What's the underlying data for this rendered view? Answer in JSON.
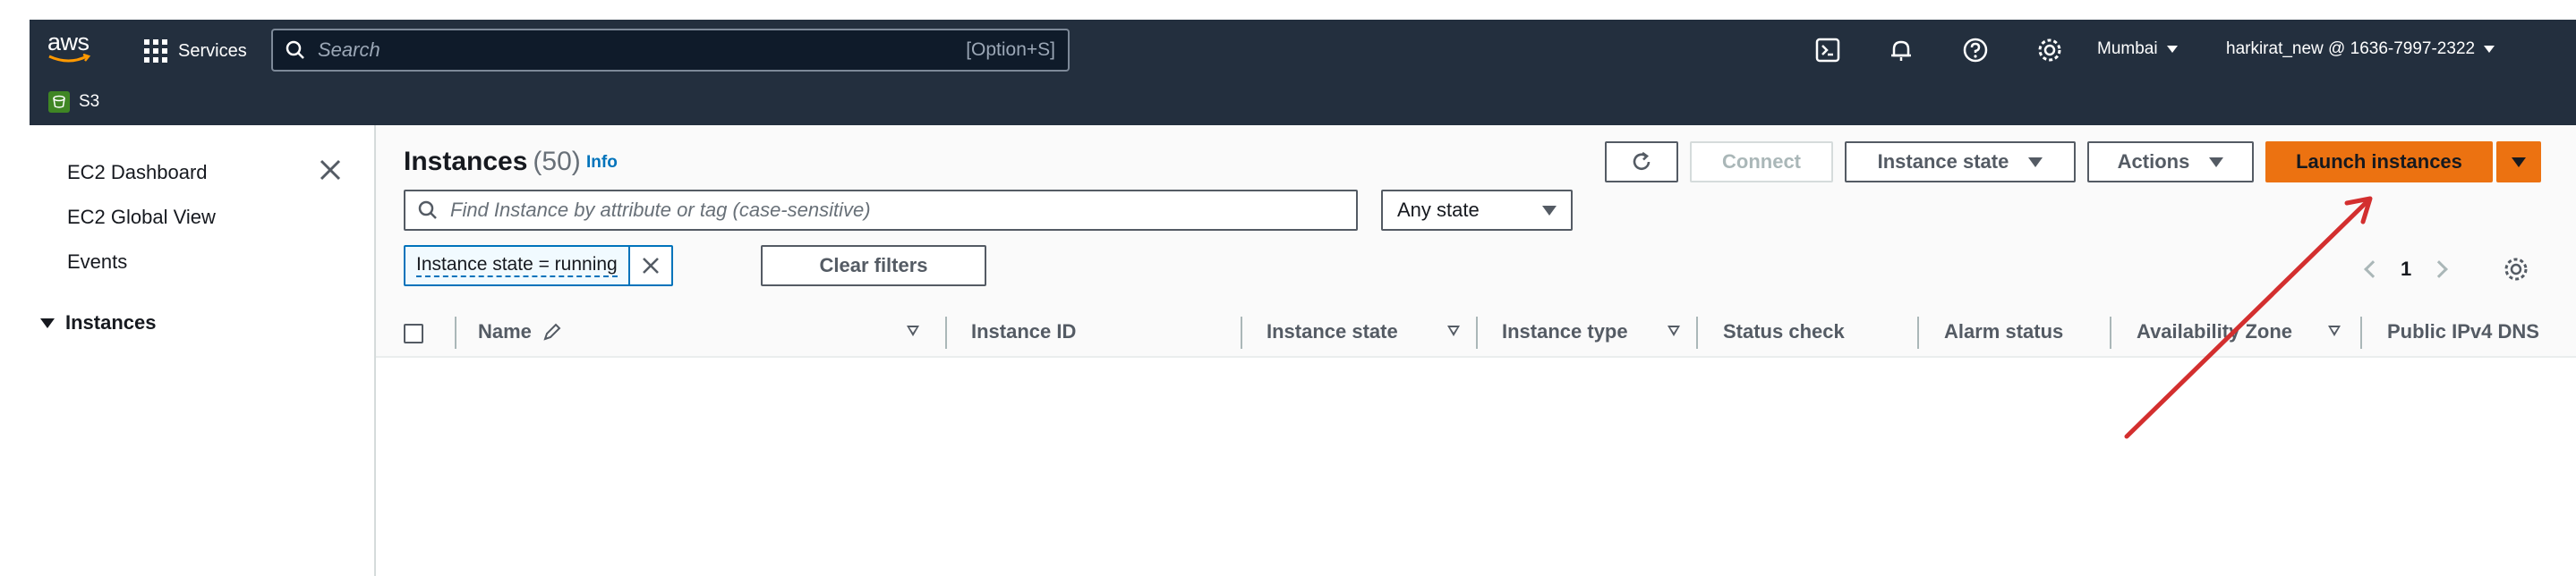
{
  "topnav": {
    "logo_text": "aws",
    "services_label": "Services",
    "search_placeholder": "Search",
    "search_shortcut": "[Option+S]",
    "region": "Mumbai",
    "account": "harkirat_new @ 1636-7997-2322",
    "service_crumb": "S3"
  },
  "sidebar": {
    "items": [
      {
        "label": "EC2 Dashboard"
      },
      {
        "label": "EC2 Global View"
      },
      {
        "label": "Events"
      }
    ],
    "section": "Instances"
  },
  "main": {
    "title": "Instances",
    "count": "(50)",
    "info": "Info",
    "buttons": {
      "connect": "Connect",
      "instance_state": "Instance state",
      "actions": "Actions",
      "launch": "Launch instances"
    },
    "filter_placeholder": "Find Instance by attribute or tag (case-sensitive)",
    "state_select": "Any state",
    "token": "Instance state = running",
    "clear_filters": "Clear filters",
    "page": "1",
    "columns": [
      "Name",
      "Instance ID",
      "Instance state",
      "Instance type",
      "Status check",
      "Alarm status",
      "Availability Zone",
      "Public IPv4 DNS"
    ]
  },
  "colors": {
    "nav_bg": "#232f3e",
    "primary": "#ec7211",
    "link": "#0073bb",
    "annotation_arrow": "#d32f2f"
  }
}
